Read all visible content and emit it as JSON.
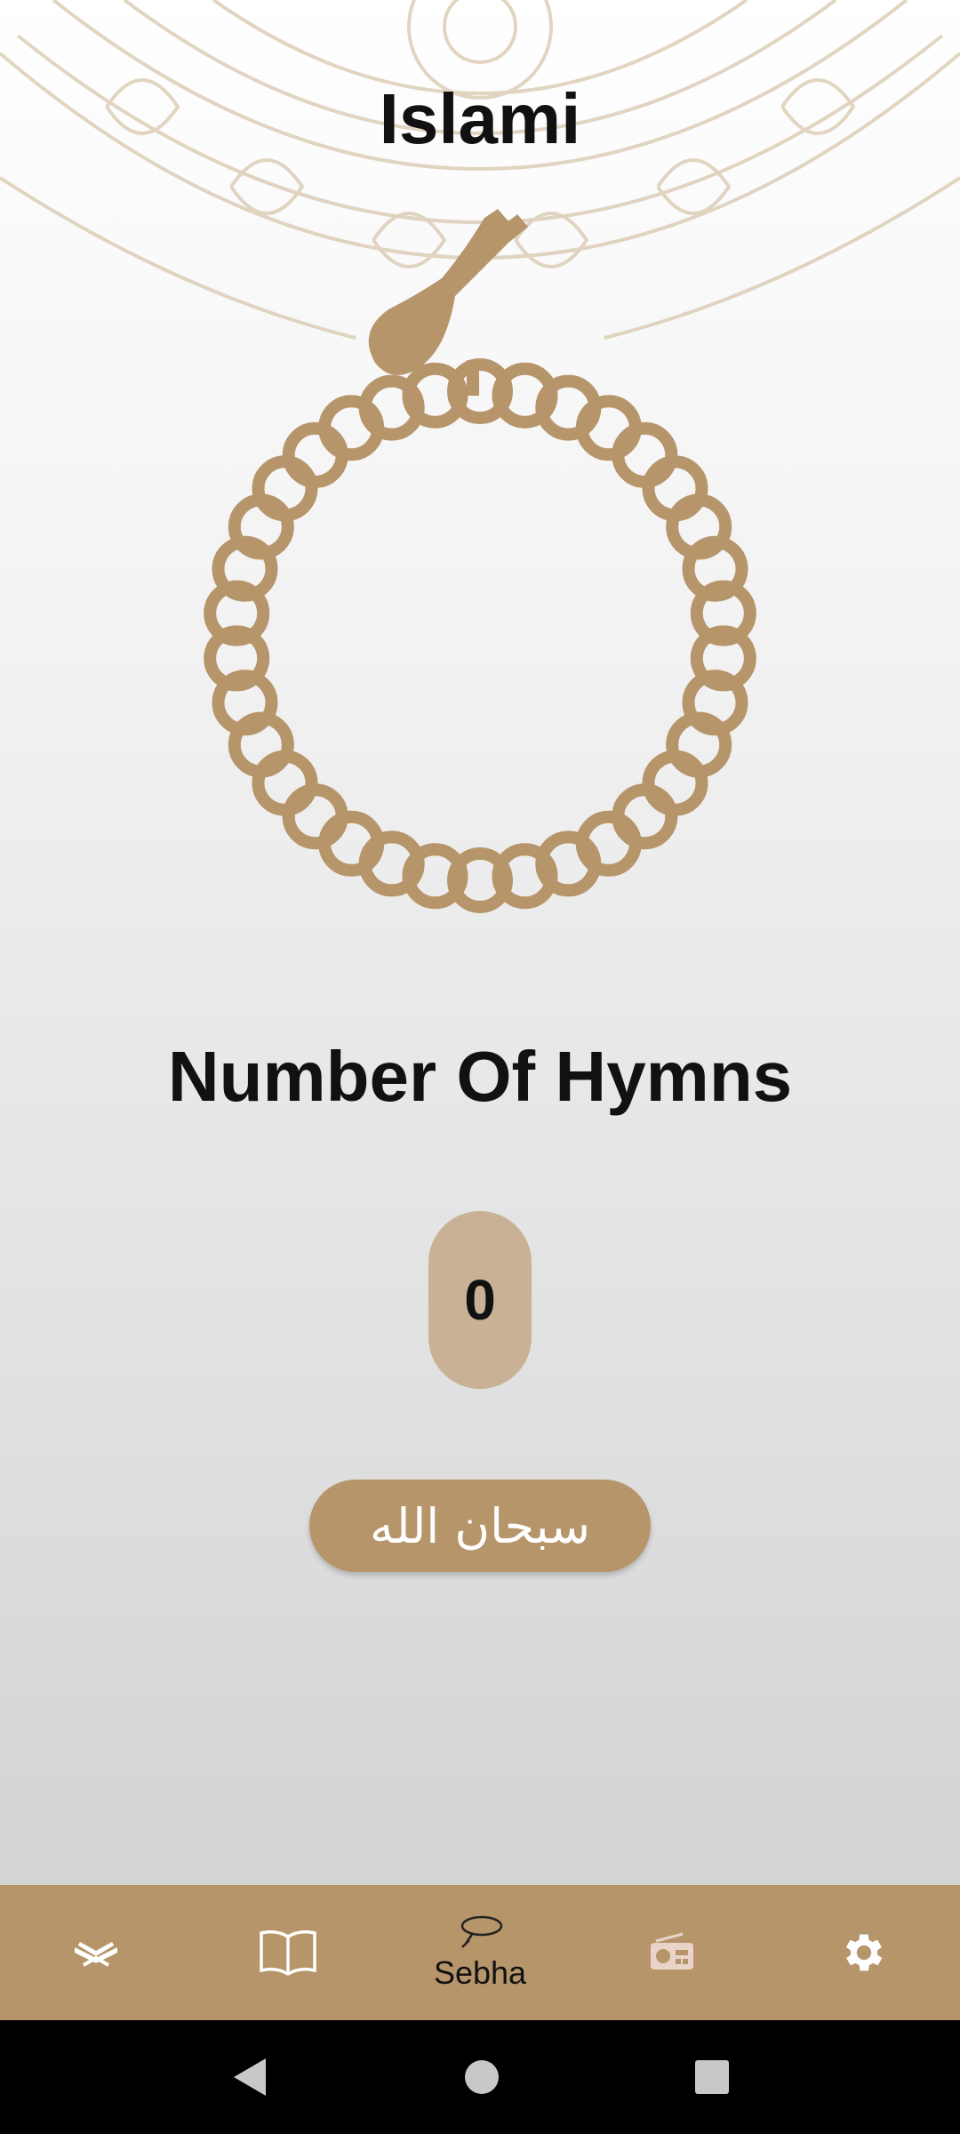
{
  "app": {
    "title": "Islami"
  },
  "main": {
    "heading": "Number Of Hymns",
    "counter": "0",
    "tasbih_label": "سبحان الله"
  },
  "bottom_nav": {
    "items": [
      {
        "icon": "quran-icon",
        "label": ""
      },
      {
        "icon": "book-icon",
        "label": ""
      },
      {
        "icon": "sebha-icon",
        "label": "Sebha",
        "active": true
      },
      {
        "icon": "radio-icon",
        "label": ""
      },
      {
        "icon": "gear-icon",
        "label": ""
      }
    ]
  },
  "system_nav": {
    "icons": [
      "back-icon",
      "home-icon",
      "recents-icon"
    ]
  },
  "colors": {
    "accent": "#b7956a",
    "counter_bg": "#c8b195",
    "text": "#111111"
  }
}
